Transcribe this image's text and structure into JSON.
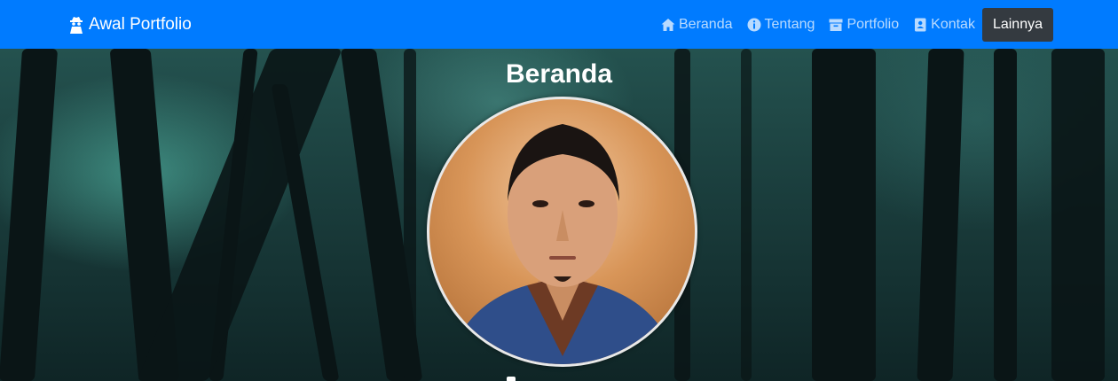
{
  "navbar": {
    "brand": {
      "label": "Awal Portfolio",
      "icon": "user-secret-icon"
    },
    "links": [
      {
        "label": "Beranda",
        "icon": "home-icon"
      },
      {
        "label": "Tentang",
        "icon": "info-circle-icon"
      },
      {
        "label": "Portfolio",
        "icon": "archive-icon"
      },
      {
        "label": "Kontak",
        "icon": "address-book-icon"
      }
    ],
    "more_label": "Lainnya"
  },
  "hero": {
    "title": "Beranda",
    "avatar": "profile-photo"
  },
  "colors": {
    "navbar_bg": "#007bff",
    "button_dark": "#343a40"
  }
}
